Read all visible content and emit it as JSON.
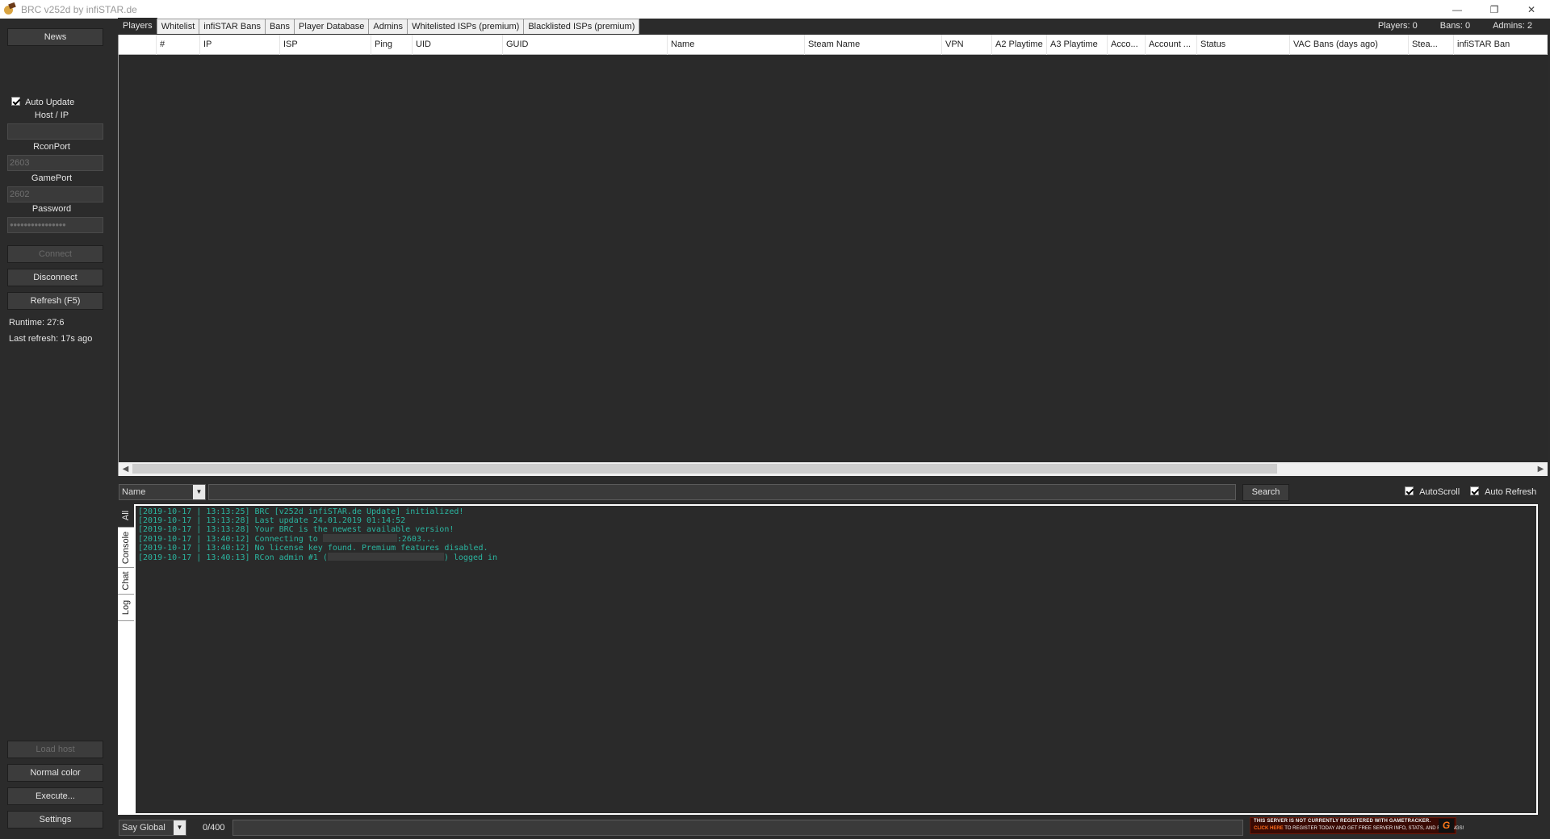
{
  "window": {
    "title": "BRC v252d by infiSTAR.de"
  },
  "sidebar": {
    "news_label": "News",
    "auto_update_label": "Auto Update",
    "host_label": "Host / IP",
    "host_value": "",
    "rconport_label": "RconPort",
    "rconport_value": "2603",
    "gameport_label": "GamePort",
    "gameport_value": "2602",
    "password_label": "Password",
    "password_value": "●●●●●●●●●●●●●●●●",
    "connect_label": "Connect",
    "disconnect_label": "Disconnect",
    "refresh_label": "Refresh (F5)",
    "runtime": "Runtime: 27:6",
    "last_refresh": "Last refresh: 17s ago",
    "load_host_label": "Load host",
    "normal_color_label": "Normal color",
    "execute_label": "Execute...",
    "settings_label": "Settings"
  },
  "tabs": [
    "Players",
    "Whitelist",
    "infiSTAR Bans",
    "Bans",
    "Player Database",
    "Admins",
    "Whitelisted ISPs (premium)",
    "Blacklisted ISPs (premium)"
  ],
  "stats": {
    "players": "Players: 0",
    "bans": "Bans: 0",
    "admins": "Admins: 2"
  },
  "grid": {
    "columns": [
      "#",
      "IP",
      "ISP",
      "Ping",
      "UID",
      "GUID",
      "Name",
      "Steam Name",
      "VPN",
      "A2 Playtime",
      "A3 Playtime",
      "Acco...",
      "Account ...",
      "Status",
      "VAC Bans (days ago)",
      "Stea...",
      "infiSTAR Ban"
    ]
  },
  "search": {
    "field_select": "Name",
    "button": "Search",
    "autoscroll": "AutoScroll",
    "autorefresh": "Auto Refresh"
  },
  "log": {
    "tabs": [
      "All",
      "Console",
      "Chat",
      "Log"
    ],
    "lines": [
      {
        "date": "2019-10-17",
        "time": "13:13:25",
        "text": "BRC [v252d infiSTAR.de Update] initialized!"
      },
      {
        "date": "2019-10-17",
        "time": "13:13:28",
        "text": "Last update 24.01.2019 01:14:52"
      },
      {
        "date": "2019-10-17",
        "time": "13:13:28",
        "text": "Your BRC is the newest available version!"
      },
      {
        "date": "2019-10-17",
        "time": "13:40:12",
        "text": "Connecting to",
        "suffix": ":2603..."
      },
      {
        "date": "2019-10-17",
        "time": "13:40:12",
        "text": "No license key found. Premium features disabled."
      },
      {
        "date": "2019-10-17",
        "time": "13:40:13",
        "text": "RCon admin #1 (",
        "suffix": ") logged in"
      }
    ]
  },
  "bottom": {
    "say_select": "Say Global",
    "counter": "0/400",
    "banner_line1": "THIS SERVER IS NOT CURRENTLY REGISTERED WITH GAMETRACKER.",
    "banner_click": "CLICK HERE",
    "banner_line2": "TO REGISTER TODAY AND GET FREE SERVER INFO, STATS, AND RANKINGS!"
  }
}
